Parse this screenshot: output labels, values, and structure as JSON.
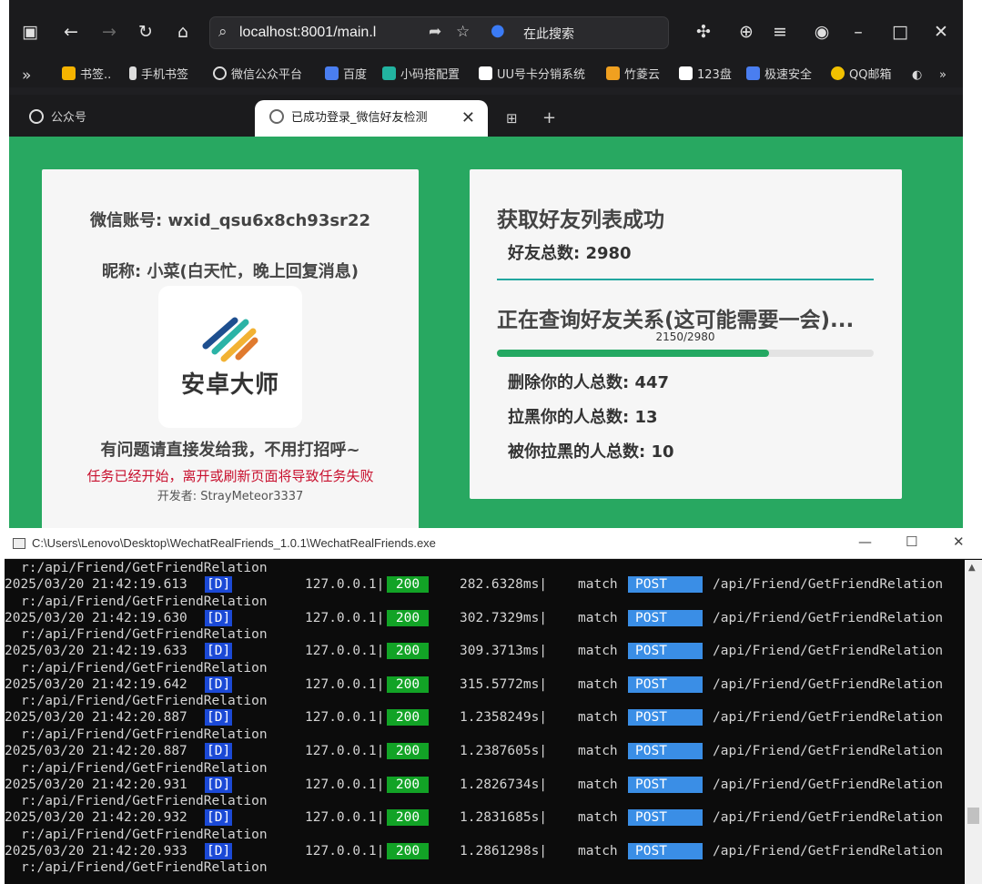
{
  "browser": {
    "url": "localhost:8001/main.l",
    "search_engine": "在此搜索",
    "bookmarks": [
      {
        "label": "书签..",
        "color": "#f5b300"
      },
      {
        "label": "手机书签",
        "color": "#dddddd"
      },
      {
        "label": "微信公众平台",
        "color": "#dddddd"
      },
      {
        "label": "百度",
        "color": "#4a7ef0"
      },
      {
        "label": "小码搭配置",
        "color": "#22b3a0"
      },
      {
        "label": "UU号卡分销系统",
        "color": "#ffffff"
      },
      {
        "label": "竹菱云",
        "color": "#f0a020"
      },
      {
        "label": "123盘",
        "color": "#ffffff"
      },
      {
        "label": "极速安全",
        "color": "#4a7ef0"
      },
      {
        "label": "QQ邮箱",
        "color": "#f0c000"
      }
    ],
    "tabs": [
      {
        "label": "公众号",
        "active": false
      },
      {
        "label": "已成功登录_微信好友检测",
        "active": true
      }
    ]
  },
  "account": {
    "wxid_line": "微信账号: wxid_qsu6x8ch93sr22",
    "nickname_line": "昵称: 小菜(白天忙，晚上回复消息)",
    "logo_text": "安卓大师",
    "contact_line": "有问题请直接发给我，不用打招呼~",
    "warning": "任务已经开始，离开或刷新页面将导致任务失败",
    "developer": "开发者: StrayMeteor3337"
  },
  "status": {
    "title": "获取好友列表成功",
    "total_friends": "好友总数: 2980",
    "query_title": "正在查询好友关系(这可能需要一会)...",
    "progress_label": "2150/2980",
    "progress": 0.7215,
    "deleted": "删除你的人总数: 447",
    "blocked_you": "拉黑你的人总数: 13",
    "blocked_by_you": "被你拉黑的人总数: 10"
  },
  "console": {
    "title": "C:\\Users\\Lenovo\\Desktop\\WechatRealFriends_1.0.1\\WechatRealFriends.exe",
    "route_text": "r:/api/Friend/GetFriendRelation",
    "rows": [
      {
        "ts": "2025/03/20 21:42:19.613",
        "lv": "[D]",
        "ip": "127.0.0.1|",
        "st": "200",
        "ms": "282.6328ms|",
        "mt": "match",
        "me": "POST",
        "pa": "/api/Friend/GetFriendRelation"
      },
      {
        "ts": "2025/03/20 21:42:19.630",
        "lv": "[D]",
        "ip": "127.0.0.1|",
        "st": "200",
        "ms": "302.7329ms|",
        "mt": "match",
        "me": "POST",
        "pa": "/api/Friend/GetFriendRelation"
      },
      {
        "ts": "2025/03/20 21:42:19.633",
        "lv": "[D]",
        "ip": "127.0.0.1|",
        "st": "200",
        "ms": "309.3713ms|",
        "mt": "match",
        "me": "POST",
        "pa": "/api/Friend/GetFriendRelation"
      },
      {
        "ts": "2025/03/20 21:42:19.642",
        "lv": "[D]",
        "ip": "127.0.0.1|",
        "st": "200",
        "ms": "315.5772ms|",
        "mt": "match",
        "me": "POST",
        "pa": "/api/Friend/GetFriendRelation"
      },
      {
        "ts": "2025/03/20 21:42:20.887",
        "lv": "[D]",
        "ip": "127.0.0.1|",
        "st": "200",
        "ms": "1.2358249s|",
        "mt": "match",
        "me": "POST",
        "pa": "/api/Friend/GetFriendRelation"
      },
      {
        "ts": "2025/03/20 21:42:20.887",
        "lv": "[D]",
        "ip": "127.0.0.1|",
        "st": "200",
        "ms": "1.2387605s|",
        "mt": "match",
        "me": "POST",
        "pa": "/api/Friend/GetFriendRelation"
      },
      {
        "ts": "2025/03/20 21:42:20.931",
        "lv": "[D]",
        "ip": "127.0.0.1|",
        "st": "200",
        "ms": "1.2826734s|",
        "mt": "match",
        "me": "POST",
        "pa": "/api/Friend/GetFriendRelation"
      },
      {
        "ts": "2025/03/20 21:42:20.932",
        "lv": "[D]",
        "ip": "127.0.0.1|",
        "st": "200",
        "ms": "1.2831685s|",
        "mt": "match",
        "me": "POST",
        "pa": "/api/Friend/GetFriendRelation"
      },
      {
        "ts": "2025/03/20 21:42:20.933",
        "lv": "[D]",
        "ip": "127.0.0.1|",
        "st": "200",
        "ms": "1.2861298s|",
        "mt": "match",
        "me": "POST",
        "pa": "/api/Friend/GetFriendRelation"
      }
    ]
  }
}
